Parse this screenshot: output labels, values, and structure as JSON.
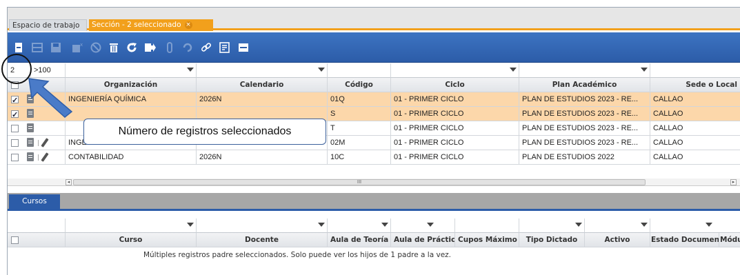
{
  "tabs": {
    "workspace": "Espacio de trabajo",
    "section": "Sección - 2 seleccionado",
    "close_glyph": "×"
  },
  "toolbar": {
    "buttons": [
      "new-icon",
      "grid-icon",
      "save-icon",
      "delete-record-icon",
      "cancel-icon",
      "trash-icon",
      "refresh-icon",
      "export-icon",
      "attach-icon",
      "history-icon",
      "link-icon",
      "checklist-icon",
      "window-icon"
    ]
  },
  "grid": {
    "selected_count": "2",
    "total_label": ">100",
    "headers": [
      "Organización",
      "Calendario",
      "Código",
      "Ciclo",
      "Plan Académico",
      "Sede o Local"
    ],
    "rows": [
      {
        "selected": true,
        "org": "INGENIERÍA QUÍMICA",
        "cal": "2026N",
        "code": "01Q",
        "cycle": "01 - PRIMER CICLO",
        "plan": "PLAN DE ESTUDIOS 2023 - RE...",
        "site": "CALLAO"
      },
      {
        "selected": true,
        "org": "",
        "cal": "",
        "code": "S",
        "cycle": "01 - PRIMER CICLO",
        "plan": "PLAN DE ESTUDIOS 2023 - RE...",
        "site": "CALLAO"
      },
      {
        "selected": false,
        "org": "",
        "cal": "",
        "code": "T",
        "cycle": "01 - PRIMER CICLO",
        "plan": "PLAN DE ESTUDIOS 2023 - RE...",
        "site": "CALLAO"
      },
      {
        "selected": false,
        "org": "INGENIERÍA EN ENERGÍA",
        "cal": "2026N",
        "code": "02M",
        "cycle": "01 - PRIMER CICLO",
        "plan": "PLAN DE ESTUDIOS 2023 - RE...",
        "site": "CALLAO"
      },
      {
        "selected": false,
        "org": "CONTABILIDAD",
        "cal": "2026N",
        "code": "10C",
        "cycle": "01 - PRIMER CICLO",
        "plan": "PLAN DE ESTUDIOS 2022",
        "site": "CALLAO"
      }
    ],
    "scroll_mark": "III"
  },
  "subtab": "Cursos",
  "child_grid": {
    "headers": [
      "Curso",
      "Docente",
      "Aula de Teoría",
      "Aula de Práctica",
      "Cupos Máximo",
      "Tipo Dictado",
      "Activo",
      "Estado Documento",
      "Módu"
    ],
    "message": "Múltiples registros padre seleccionados. Solo puede ver los hijos de 1 padre a la vez."
  },
  "annotation": {
    "callout": "Número de registros seleccionados"
  }
}
